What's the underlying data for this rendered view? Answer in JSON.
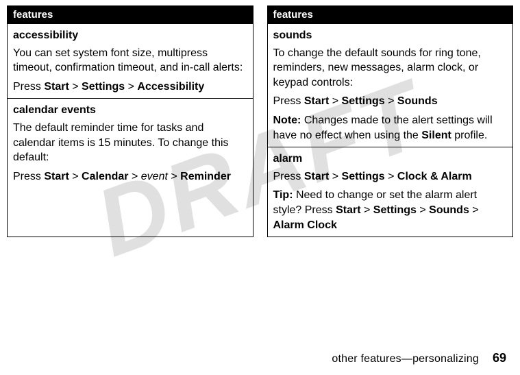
{
  "watermark": "DRAFT",
  "left": {
    "header": "features",
    "rows": [
      {
        "title": "accessibility",
        "desc": "You can set system font size, multipress timeout, confirmation timeout, and in-call alerts:",
        "press_prefix": "Press ",
        "path": [
          "Start",
          ">",
          "Settings",
          ">",
          "Accessibility"
        ]
      },
      {
        "title": "calendar events",
        "desc": "The default reminder time for tasks and calendar items is 15 minutes. To change this default:",
        "press_prefix": "Press ",
        "path": [
          "Start",
          ">",
          "Calendar",
          ">",
          "event",
          ">",
          "Reminder"
        ]
      }
    ]
  },
  "right": {
    "header": "features",
    "rows": [
      {
        "title": "sounds",
        "desc": "To change the default sounds for ring tone, reminders, new messages, alarm clock, or keypad controls:",
        "press_prefix": "Press ",
        "path": [
          "Start",
          ">",
          "Settings",
          ">",
          "Sounds"
        ],
        "note_lead": "Note:",
        "note_text_1": " Changes made to the alert settings will have no effect when using the ",
        "note_bold": "Silent",
        "note_text_2": " profile."
      },
      {
        "title": "alarm",
        "press_prefix": "Press ",
        "path": [
          "Start",
          ">",
          "Settings",
          ">",
          "Clock & Alarm"
        ],
        "tip_lead": "Tip:",
        "tip_text_1": " Need to change or set the alarm alert style? Press ",
        "tip_path": [
          "Start",
          ">",
          "Settings",
          ">",
          "Sounds",
          ">",
          "Alarm Clock"
        ]
      }
    ]
  },
  "footer": {
    "section": "other features—personalizing",
    "page": "69"
  }
}
